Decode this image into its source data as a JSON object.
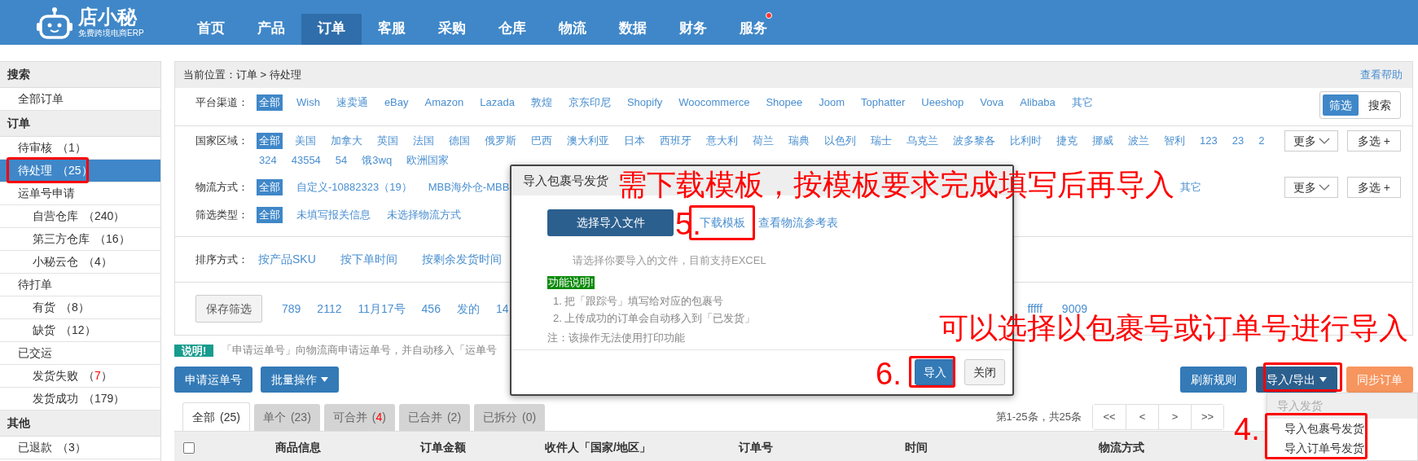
{
  "brand": {
    "name": "店小秘",
    "tagline": "免费跨境电商ERP"
  },
  "nav": [
    {
      "label": "首页",
      "selected": false,
      "dot": false
    },
    {
      "label": "产品",
      "selected": false,
      "dot": false
    },
    {
      "label": "订单",
      "selected": true,
      "dot": false
    },
    {
      "label": "客服",
      "selected": false,
      "dot": false
    },
    {
      "label": "采购",
      "selected": false,
      "dot": false
    },
    {
      "label": "仓库",
      "selected": false,
      "dot": false
    },
    {
      "label": "物流",
      "selected": false,
      "dot": false
    },
    {
      "label": "数据",
      "selected": false,
      "dot": false
    },
    {
      "label": "财务",
      "selected": false,
      "dot": false
    },
    {
      "label": "服务",
      "selected": false,
      "dot": true
    }
  ],
  "sidebar": [
    {
      "title": "搜索",
      "items": [
        {
          "label": "全部订单",
          "selected": false
        }
      ]
    },
    {
      "title": "订单",
      "items": [
        {
          "label": "待审核",
          "count": "（1）",
          "alert": false,
          "selected": false
        },
        {
          "label": "待处理",
          "count": "（25）",
          "alert": false,
          "selected": true
        },
        {
          "label": "运单号申请",
          "selected": false,
          "children": [
            {
              "label": "自营仓库",
              "count": "（240）",
              "alert": false,
              "selected": false
            },
            {
              "label": "第三方仓库",
              "count": "（16）",
              "alert": false,
              "selected": false
            },
            {
              "label": "小秘云仓",
              "count": "（4）",
              "alert": false,
              "selected": false
            }
          ]
        },
        {
          "label": "待打单",
          "selected": false,
          "children": [
            {
              "label": "有货",
              "count": "（8）",
              "alert": false,
              "selected": false
            },
            {
              "label": "缺货",
              "count": "（12）",
              "alert": false,
              "selected": false
            }
          ]
        },
        {
          "label": "已交运",
          "selected": false,
          "children": [
            {
              "label": "发货失败",
              "count": "（7）",
              "alert": true,
              "selected": false
            },
            {
              "label": "发货成功",
              "count": "（179）",
              "alert": false,
              "selected": false
            }
          ]
        }
      ]
    },
    {
      "title": "其他",
      "items": [
        {
          "label": "已退款",
          "count": "（3）",
          "alert": false,
          "selected": false
        }
      ]
    }
  ],
  "breadcrumb": {
    "label": "当前位置：",
    "path": "订单 > 待处理"
  },
  "help_link": "查看帮助",
  "filters": [
    {
      "label": "平台渠道：",
      "options": [
        {
          "label": "全部",
          "selected": true
        },
        {
          "label": "Wish",
          "selected": false
        },
        {
          "label": "速卖通",
          "selected": false
        },
        {
          "label": "eBay",
          "selected": false
        },
        {
          "label": "Amazon",
          "selected": false
        },
        {
          "label": "Lazada",
          "selected": false
        },
        {
          "label": "敦煌",
          "selected": false
        },
        {
          "label": "京东印尼",
          "selected": false
        },
        {
          "label": "Shopify",
          "selected": false
        },
        {
          "label": "Woocommerce",
          "selected": false
        },
        {
          "label": "Shopee",
          "selected": false
        },
        {
          "label": "Joom",
          "selected": false
        },
        {
          "label": "Tophatter",
          "selected": false
        },
        {
          "label": "Ueeshop",
          "selected": false
        },
        {
          "label": "Vova",
          "selected": false
        },
        {
          "label": "Alibaba",
          "selected": false
        },
        {
          "label": "其它",
          "selected": false
        }
      ],
      "toggle": [
        {
          "label": "筛选",
          "selected": true
        },
        {
          "label": "搜索",
          "selected": false
        }
      ]
    },
    {
      "label": "国家区域：",
      "options": [
        {
          "label": "全部",
          "selected": true
        },
        {
          "label": "美国",
          "selected": false
        },
        {
          "label": "加拿大",
          "selected": false
        },
        {
          "label": "英国",
          "selected": false
        },
        {
          "label": "法国",
          "selected": false
        },
        {
          "label": "德国",
          "selected": false
        },
        {
          "label": "俄罗斯",
          "selected": false
        },
        {
          "label": "巴西",
          "selected": false
        },
        {
          "label": "澳大利亚",
          "selected": false
        },
        {
          "label": "日本",
          "selected": false
        },
        {
          "label": "西班牙",
          "selected": false
        },
        {
          "label": "意大利",
          "selected": false
        },
        {
          "label": "荷兰",
          "selected": false
        },
        {
          "label": "瑞典",
          "selected": false
        },
        {
          "label": "以色列",
          "selected": false
        },
        {
          "label": "瑞士",
          "selected": false
        },
        {
          "label": "乌克兰",
          "selected": false
        },
        {
          "label": "波多黎各",
          "selected": false
        },
        {
          "label": "比利时",
          "selected": false
        },
        {
          "label": "捷克",
          "selected": false
        },
        {
          "label": "挪威",
          "selected": false
        },
        {
          "label": "波兰",
          "selected": false
        },
        {
          "label": "智利",
          "selected": false
        },
        {
          "label": "123",
          "selected": false
        },
        {
          "label": "23",
          "selected": false
        },
        {
          "label": "2",
          "selected": false
        },
        {
          "label": "324",
          "selected": false
        },
        {
          "label": "43554",
          "selected": false
        },
        {
          "label": "54",
          "selected": false
        },
        {
          "label": "饿3wq",
          "selected": false
        },
        {
          "label": "欧洲国家",
          "selected": false
        }
      ],
      "actions": [
        {
          "label": "更多",
          "kind": "dropdown"
        },
        {
          "label": "多选 +",
          "kind": "plain"
        }
      ]
    },
    {
      "label": "物流方式：",
      "options": [
        {
          "label": "全部",
          "selected": true
        },
        {
          "label": "自定义-10882323（19）",
          "selected": false
        },
        {
          "label": "MBB海外仓-MBB",
          "selected": false
        }
      ],
      "trailing_options": [
        {
          "label": "其它",
          "selected": false
        }
      ],
      "actions": [
        {
          "label": "更多",
          "kind": "dropdown"
        },
        {
          "label": "多选 +",
          "kind": "plain"
        }
      ]
    },
    {
      "label": "筛选类型：",
      "options": [
        {
          "label": "全部",
          "selected": true
        },
        {
          "label": "未填写报关信息",
          "selected": false
        },
        {
          "label": "未选择物流方式",
          "selected": false
        }
      ]
    }
  ],
  "sort": {
    "label": "排序方式：",
    "options": [
      "按产品SKU",
      "按下单时间",
      "按剩余发货时间"
    ]
  },
  "saved_filters": {
    "button": "保存筛选",
    "items": [
      "789",
      "2112",
      "11月17号",
      "456",
      "发的",
      "14"
    ],
    "trailing_items": [
      "fffff",
      "9009"
    ]
  },
  "notice": {
    "badge": "说明!",
    "text": "「申请运单号」向物流商申请运单号，并自动移入「运单号"
  },
  "left_buttons": [
    {
      "label": "申请运单号",
      "kind": "primary"
    },
    {
      "label": "批量操作",
      "kind": "menu"
    }
  ],
  "right_buttons": [
    {
      "label": "刷新规则",
      "kind": "primary"
    },
    {
      "label": "导入/导出",
      "kind": "menu-dark"
    },
    {
      "label": "同步订单",
      "kind": "orange"
    }
  ],
  "tabs": [
    {
      "label": "全部",
      "count": "(25)",
      "alert": false,
      "selected": true
    },
    {
      "label": "单个",
      "count": "(23)",
      "alert": false,
      "selected": false
    },
    {
      "label": "可合并",
      "count": "(4)",
      "alert": true,
      "selected": false
    },
    {
      "label": "已合并",
      "count": "(2)",
      "alert": false,
      "selected": false
    },
    {
      "label": "已拆分",
      "count": "(0)",
      "alert": false,
      "selected": false
    }
  ],
  "pagination": {
    "info": "第1-25条，共25条",
    "buttons": [
      "<<",
      "<",
      ">",
      ">>"
    ]
  },
  "table": {
    "select_all": {
      "checked": false
    },
    "columns": [
      "商品信息",
      "订单金额",
      "收件人「国家/地区」",
      "订单号",
      "时间",
      "物流方式"
    ]
  },
  "dialog": {
    "title": "导入包裹号发货",
    "choose_file": "选择导入文件",
    "links": [
      "下载模板",
      "查看物流参考表"
    ],
    "hint": "请选择你要导入的文件，目前支持EXCEL",
    "badge": "功能说明!",
    "steps": [
      "1. 把「跟踪号」填写给对应的包裹号",
      "2. 上传成功的订单会自动移入到「已发货」"
    ],
    "note": "注：该操作无法使用打印功能",
    "buttons": [
      {
        "label": "导入",
        "kind": "primary"
      },
      {
        "label": "关闭",
        "kind": "default"
      }
    ]
  },
  "import_menu": {
    "header": "导入发货",
    "items": [
      "导入包裹号发货",
      "导入订单号发货"
    ]
  },
  "annotations": {
    "notes": [
      "需下载模板，按模板要求完成填写后再导入",
      "可以选择以包裹号或订单号进行导入"
    ],
    "steps": [
      "5.",
      "6.",
      "4."
    ]
  }
}
